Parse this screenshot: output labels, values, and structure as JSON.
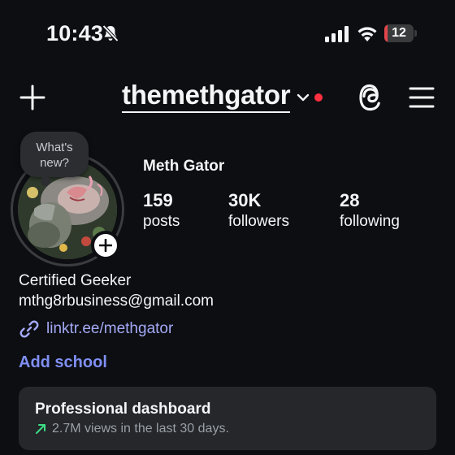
{
  "status_bar": {
    "time": "10:43",
    "battery_level": "12",
    "battery_fraction": 0.12,
    "battery_color": "#e0464b",
    "icons": [
      "bell-slash-icon",
      "cellular-signal-icon",
      "wifi-icon",
      "battery-icon"
    ]
  },
  "header": {
    "username": "themethgator",
    "notification_dot_color": "#ff3040",
    "icons": [
      "plus-icon",
      "chevron-down-icon",
      "threads-icon",
      "hamburger-menu-icon"
    ]
  },
  "profile": {
    "note_placeholder": "What's\nnew?",
    "display_name": "Meth Gator",
    "stats": [
      {
        "value": "159",
        "label": "posts"
      },
      {
        "value": "30K",
        "label": "followers"
      },
      {
        "value": "28",
        "label": "following"
      }
    ],
    "bio": [
      "Certified Geeker",
      "mthg8rbusiness@gmail.com"
    ],
    "link": "linktr.ee/methgator",
    "add_school": "Add school"
  },
  "dashboard": {
    "title": "Professional dashboard",
    "subtitle": "2.7M views in the last 30 days.",
    "trend_color": "#3ddc84"
  },
  "colors": {
    "background": "#0c0e12",
    "link": "#a4a9f5",
    "accent": "#7f8ff3"
  }
}
